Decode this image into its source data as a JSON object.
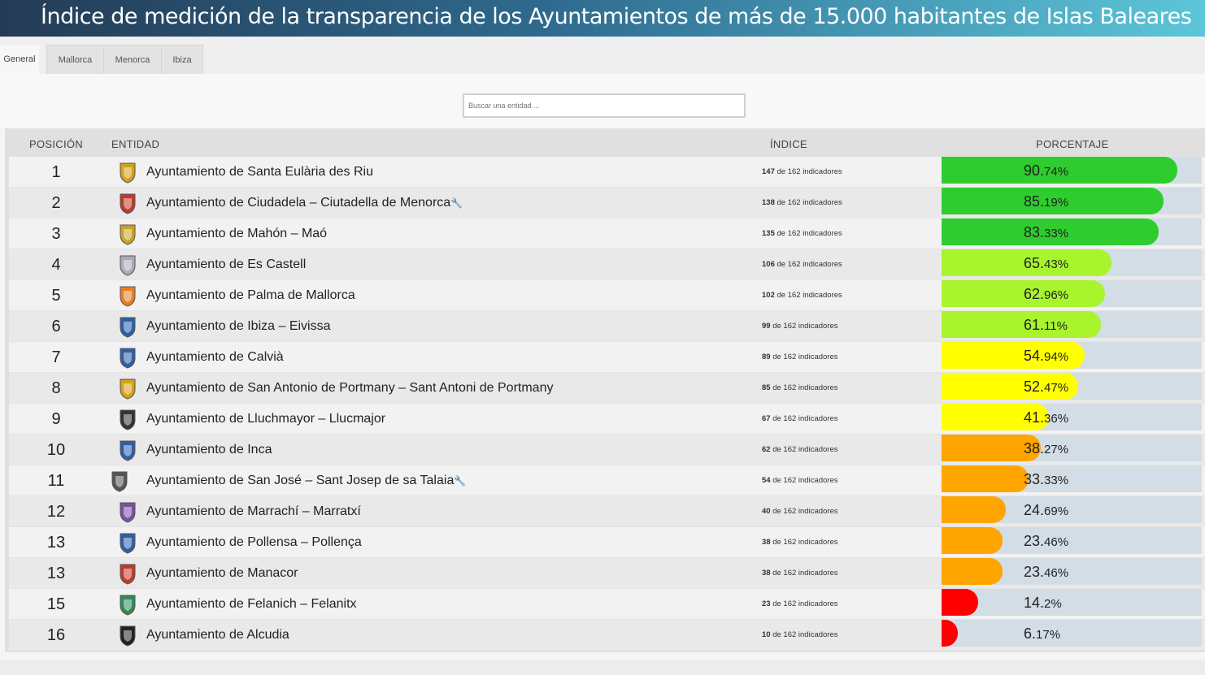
{
  "header": {
    "title": "Índice de medición de la transparencia de los Ayuntamientos de más de 15.000 habitantes de Islas Baleares"
  },
  "tabs": [
    {
      "label": "General",
      "active": true
    },
    {
      "label": "Mallorca",
      "active": false
    },
    {
      "label": "Menorca",
      "active": false
    },
    {
      "label": "Ibiza",
      "active": false
    }
  ],
  "search": {
    "placeholder": "Buscar una entidad ..."
  },
  "table": {
    "headers": {
      "position": "POSICIÓN",
      "entity": "ENTIDAD",
      "index": "ÍNDICE",
      "percent": "PORCENTAJE"
    },
    "of_text": " de 162 indicadores",
    "rows": [
      {
        "pos": "1",
        "name": "Ayuntamiento de Santa Eulària des Riu",
        "count": "147",
        "int": "90.",
        "dec": "74%",
        "value": 90.74,
        "color": "#2ecc2e",
        "logo": "crest-icon"
      },
      {
        "pos": "2",
        "name": "Ayuntamiento de Ciudadela – Ciutadella de Menorca",
        "wrench": true,
        "count": "138",
        "int": "85.",
        "dec": "19%",
        "value": 85.19,
        "color": "#2ecc2e",
        "logo": "crest-icon"
      },
      {
        "pos": "3",
        "name": "Ayuntamiento de Mahón – Maó",
        "count": "135",
        "int": "83.",
        "dec": "33%",
        "value": 83.33,
        "color": "#2ecc2e",
        "logo": "crest-icon"
      },
      {
        "pos": "4",
        "name": "Ayuntamiento de Es Castell",
        "count": "106",
        "int": "65.",
        "dec": "43%",
        "value": 65.43,
        "color": "#a8f52e",
        "logo": "crest-icon"
      },
      {
        "pos": "5",
        "name": "Ayuntamiento de Palma de Mallorca",
        "count": "102",
        "int": "62.",
        "dec": "96%",
        "value": 62.96,
        "color": "#a8f52e",
        "logo": "crest-icon"
      },
      {
        "pos": "6",
        "name": "Ayuntamiento de Ibiza – Eivissa",
        "count": "99",
        "int": "61.",
        "dec": "11%",
        "value": 61.11,
        "color": "#a8f52e",
        "logo": "crest-icon"
      },
      {
        "pos": "7",
        "name": "Ayuntamiento de Calvià",
        "count": "89",
        "int": "54.",
        "dec": "94%",
        "value": 54.94,
        "color": "#ffff00",
        "logo": "crest-icon"
      },
      {
        "pos": "8",
        "name": "Ayuntamiento de San Antonio de Portmany – Sant Antoni de Portmany",
        "count": "85",
        "int": "52.",
        "dec": "47%",
        "value": 52.47,
        "color": "#ffff00",
        "logo": "crest-icon"
      },
      {
        "pos": "9",
        "name": "Ayuntamiento de Lluchmayor – Llucmajor",
        "count": "67",
        "int": "41.",
        "dec": "36%",
        "value": 41.36,
        "color": "#ffff00",
        "logo": "crest-icon"
      },
      {
        "pos": "10",
        "name": "Ayuntamiento de Inca",
        "count": "62",
        "int": "38.",
        "dec": "27%",
        "value": 38.27,
        "color": "#ffa500",
        "logo": "crest-icon"
      },
      {
        "pos": "11",
        "name": "Ayuntamiento de San José – Sant Josep de sa Talaia",
        "wrench": true,
        "count": "54",
        "int": "33.",
        "dec": "33%",
        "value": 33.33,
        "color": "#ffa500",
        "logo": "crest-icon"
      },
      {
        "pos": "12",
        "name": "Ayuntamiento de Marrachí – Marratxí",
        "count": "40",
        "int": "24.",
        "dec": "69%",
        "value": 24.69,
        "color": "#ffa500",
        "logo": "crest-icon"
      },
      {
        "pos": "13",
        "name": "Ayuntamiento de Pollensa – Pollença",
        "count": "38",
        "int": "23.",
        "dec": "46%",
        "value": 23.46,
        "color": "#ffa500",
        "logo": "crest-icon"
      },
      {
        "pos": "13",
        "name": "Ayuntamiento de Manacor",
        "count": "38",
        "int": "23.",
        "dec": "46%",
        "value": 23.46,
        "color": "#ffa500",
        "logo": "crest-icon"
      },
      {
        "pos": "15",
        "name": "Ayuntamiento de Felanich – Felanitx",
        "count": "23",
        "int": "14.",
        "dec": "2%",
        "value": 14.2,
        "color": "#ff0000",
        "logo": "crest-icon"
      },
      {
        "pos": "16",
        "name": "Ayuntamiento de Alcudia",
        "count": "10",
        "int": "6.",
        "dec": "17%",
        "value": 6.17,
        "color": "#ff0000",
        "logo": "crest-icon"
      }
    ]
  }
}
